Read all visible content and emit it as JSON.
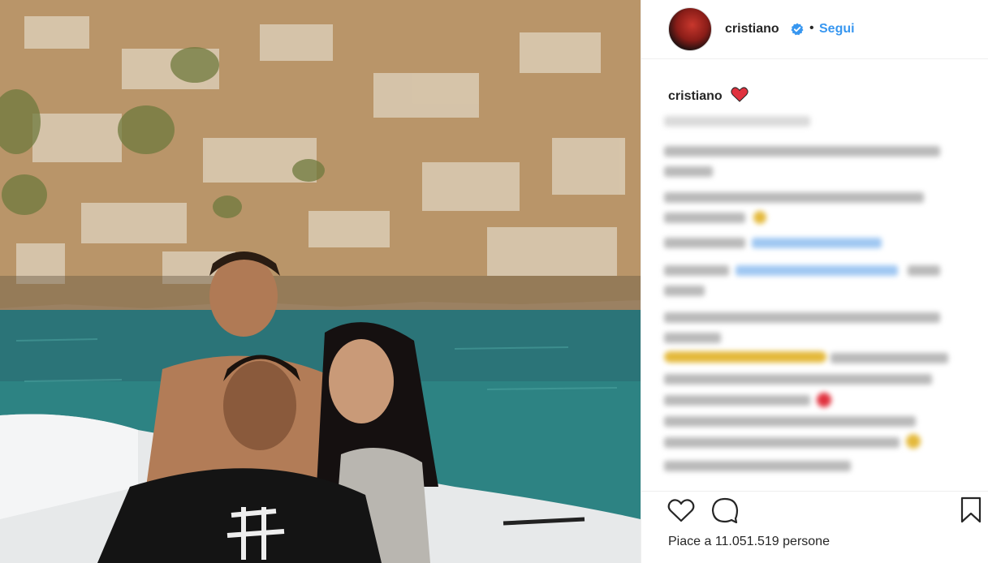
{
  "header": {
    "username": "cristiano",
    "separator": "•",
    "follow_label": "Segui"
  },
  "caption": {
    "username": "cristiano"
  },
  "likes": {
    "text": "Piace a 11.051.519 persone"
  },
  "icons": {
    "avatar": "avatar",
    "verified": "verified-badge-icon",
    "caption_emoji": "red-heart-icon",
    "like": "heart-icon",
    "comment": "comment-icon",
    "save": "bookmark-icon"
  },
  "colors": {
    "accent": "#3897f0",
    "text": "#262626",
    "border": "#efefef",
    "heart": "#e0323e"
  }
}
